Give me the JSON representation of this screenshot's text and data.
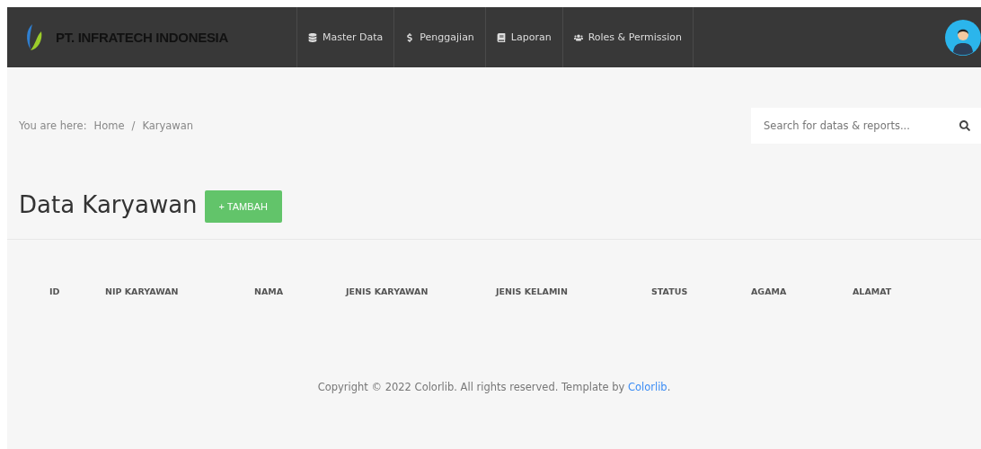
{
  "brand": {
    "name": "PT. INFRATECH INDONESIA"
  },
  "nav": [
    {
      "kind": "database",
      "label": "Master Data"
    },
    {
      "kind": "dollar",
      "label": "Penggajian"
    },
    {
      "kind": "book",
      "label": "Laporan"
    },
    {
      "kind": "users",
      "label": "Roles & Permission"
    }
  ],
  "breadcrumb": {
    "prefix": "You are here:",
    "items": [
      "Home",
      "Karyawan"
    ],
    "separator": "/"
  },
  "search": {
    "placeholder": "Search for datas & reports..."
  },
  "page_title": "Data Karyawan",
  "add_button": "+ TAMBAH",
  "table": {
    "columns": [
      "ID",
      "NIP KARYAWAN",
      "NAMA",
      "JENIS KARYAWAN",
      "JENIS KELAMIN",
      "STATUS",
      "AGAMA",
      "ALAMAT"
    ]
  },
  "footer": {
    "text": "Copyright © 2022 Colorlib. All rights reserved. Template by ",
    "link": "Colorlib",
    "suffix": "."
  }
}
